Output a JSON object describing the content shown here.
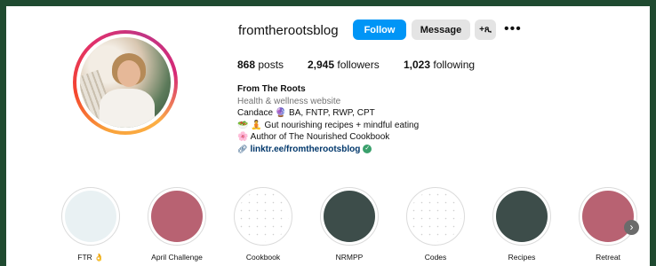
{
  "profile": {
    "username": "fromtherootsblog",
    "buttons": {
      "follow": "Follow",
      "message": "Message",
      "suggest": "+ጺ"
    },
    "more_icon": "more-horizontal-icon",
    "stats": {
      "posts_count": "868",
      "posts_label": "posts",
      "followers_count": "2,945",
      "followers_label": "followers",
      "following_count": "1,023",
      "following_label": "following"
    },
    "bio": {
      "name": "From The Roots",
      "category": "Health & wellness website",
      "line1": "Candace 🔮 BA, FNTP, RWP, CPT",
      "line2": "🥗 🧘 Gut nourishing recipes + mindful eating",
      "line3": "🌸 Author of The Nourished Cookbook",
      "link": "linktr.ee/fromtherootsblog"
    }
  },
  "highlights": [
    {
      "label": "FTR 👌",
      "color": "#e9f1f3"
    },
    {
      "label": "April Challenge",
      "color": "#b86272"
    },
    {
      "label": "Cookbook",
      "color": "speckle"
    },
    {
      "label": "NRMPP",
      "color": "#3d4d4a"
    },
    {
      "label": "Codes",
      "color": "speckle"
    },
    {
      "label": "Recipes",
      "color": "#3d4d4a"
    },
    {
      "label": "Retreat",
      "color": "#b86272"
    }
  ],
  "colors": {
    "accent": "#0095f6",
    "background": "#1f4a30",
    "verified": "#3aa06c"
  }
}
